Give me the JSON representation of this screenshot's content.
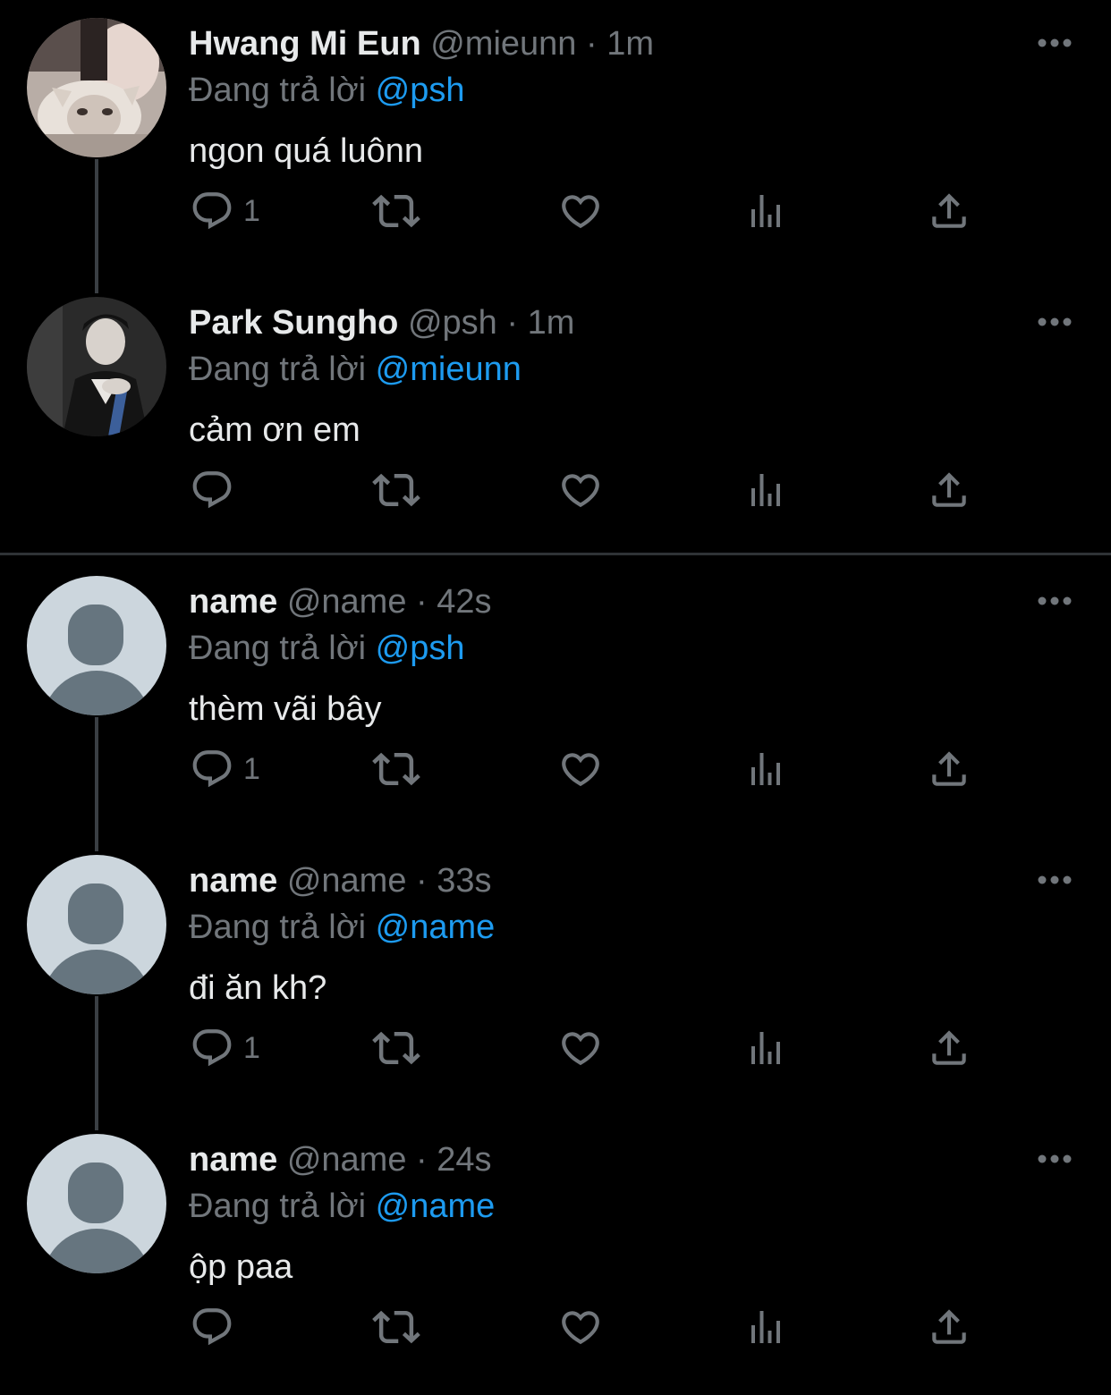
{
  "colors": {
    "background": "#000000",
    "text": "#e7e9ea",
    "muted": "#71767b",
    "accent": "#1d9bf0",
    "thread_line": "#3a3f44",
    "divider": "#2f3336"
  },
  "tweets": [
    {
      "display_name": "Hwang Mi Eun",
      "handle": "@mieunn",
      "separator": "·",
      "time": "1m",
      "replying_prefix": "Đang trả lời",
      "replying_to": "@psh",
      "text": "ngon quá luônn",
      "reply_count": "1",
      "avatar": "photo-girl-with-cat"
    },
    {
      "display_name": "Park Sungho",
      "handle": "@psh",
      "separator": "·",
      "time": "1m",
      "replying_prefix": "Đang trả lời",
      "replying_to": "@mieunn",
      "text": "cảm ơn em",
      "reply_count": "",
      "avatar": "photo-boy-dark"
    },
    {
      "display_name": "name",
      "handle": "@name",
      "separator": "·",
      "time": "42s",
      "replying_prefix": "Đang trả lời",
      "replying_to": "@psh",
      "text": "thèm vãi bây",
      "reply_count": "1",
      "avatar": "default-profile-icon"
    },
    {
      "display_name": "name",
      "handle": "@name",
      "separator": "·",
      "time": "33s",
      "replying_prefix": "Đang trả lời",
      "replying_to": "@name",
      "text": "đi ăn kh?",
      "reply_count": "1",
      "avatar": "default-profile-icon"
    },
    {
      "display_name": "name",
      "handle": "@name",
      "separator": "·",
      "time": "24s",
      "replying_prefix": "Đang trả lời",
      "replying_to": "@name",
      "text": "ộp paa",
      "reply_count": "",
      "avatar": "default-profile-icon"
    }
  ],
  "icons": {
    "reply": "reply-icon",
    "retweet": "retweet-icon",
    "like": "like-icon",
    "views": "views-icon",
    "share": "share-icon",
    "more": "more-options-icon"
  }
}
